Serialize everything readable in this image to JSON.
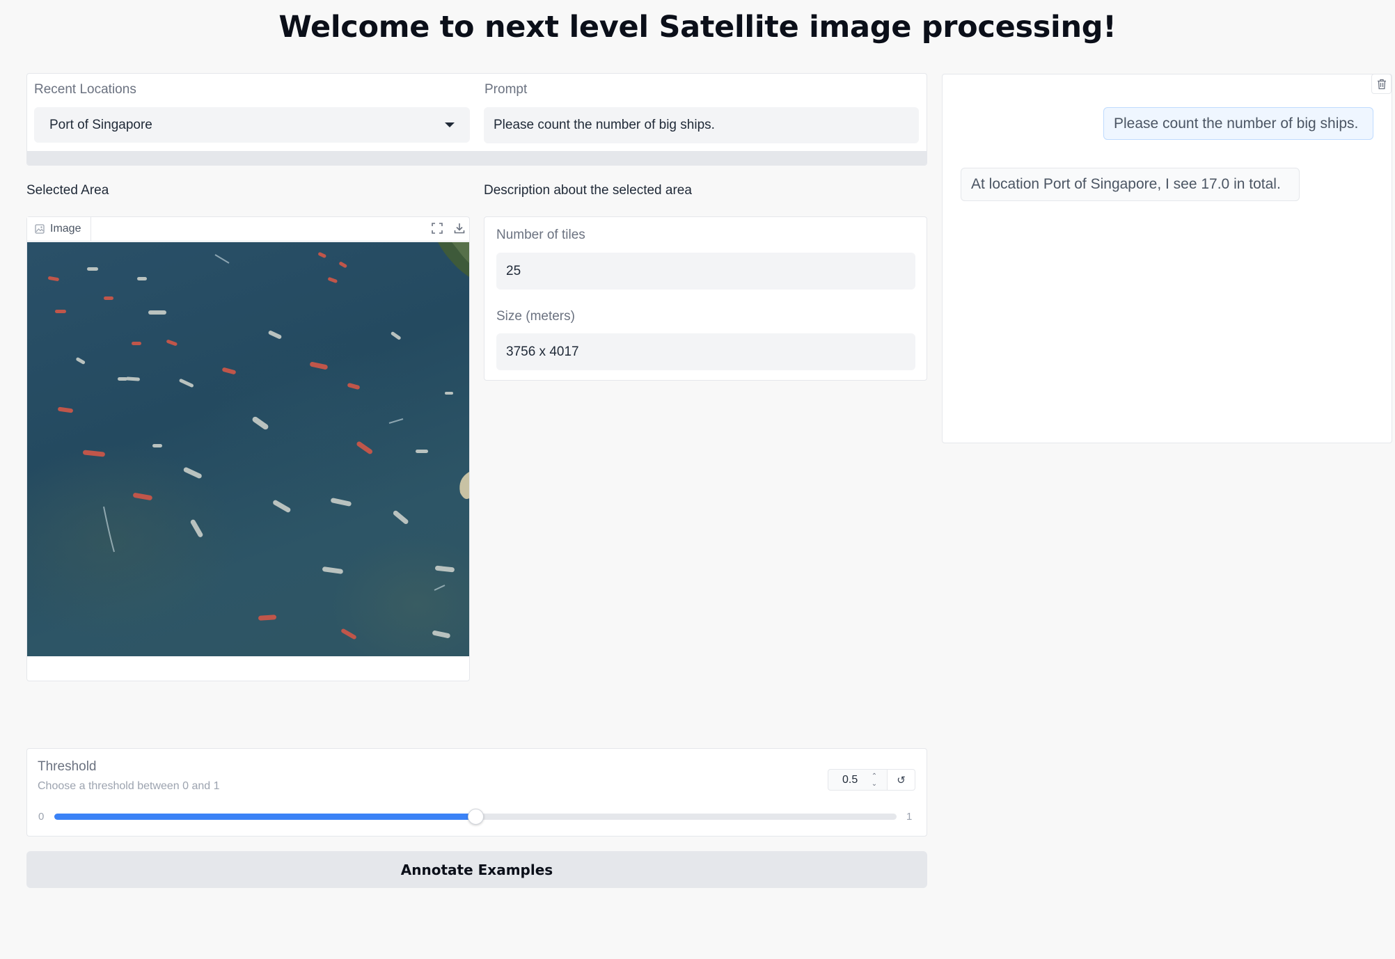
{
  "title": "Welcome to next level Satellite image processing!",
  "location": {
    "label": "Recent Locations",
    "selected": "Port of Singapore"
  },
  "prompt": {
    "label": "Prompt",
    "value": "Please count the number of big ships."
  },
  "selected_area": {
    "label": "Selected Area",
    "image_tab_label": "Image"
  },
  "description": {
    "label": "Description about the selected area",
    "tiles_label": "Number of tiles",
    "tiles_value": "25",
    "size_label": "Size (meters)",
    "size_value": "3756 x 4017"
  },
  "chat": {
    "user_message": "Please count the number of big ships.",
    "bot_message": "At location Port of Singapore, I see 17.0 in total."
  },
  "threshold": {
    "label": "Threshold",
    "info": "Choose a threshold between 0 and 1",
    "value": "0.5",
    "min": "0",
    "max": "1",
    "fraction": 0.5
  },
  "annotate_button": "Annotate Examples",
  "colors": {
    "accent": "#3b82f6",
    "page_bg": "#f8f8f8",
    "user_bubble_bg": "#eff6ff",
    "user_bubble_border": "#bfdbfe"
  }
}
